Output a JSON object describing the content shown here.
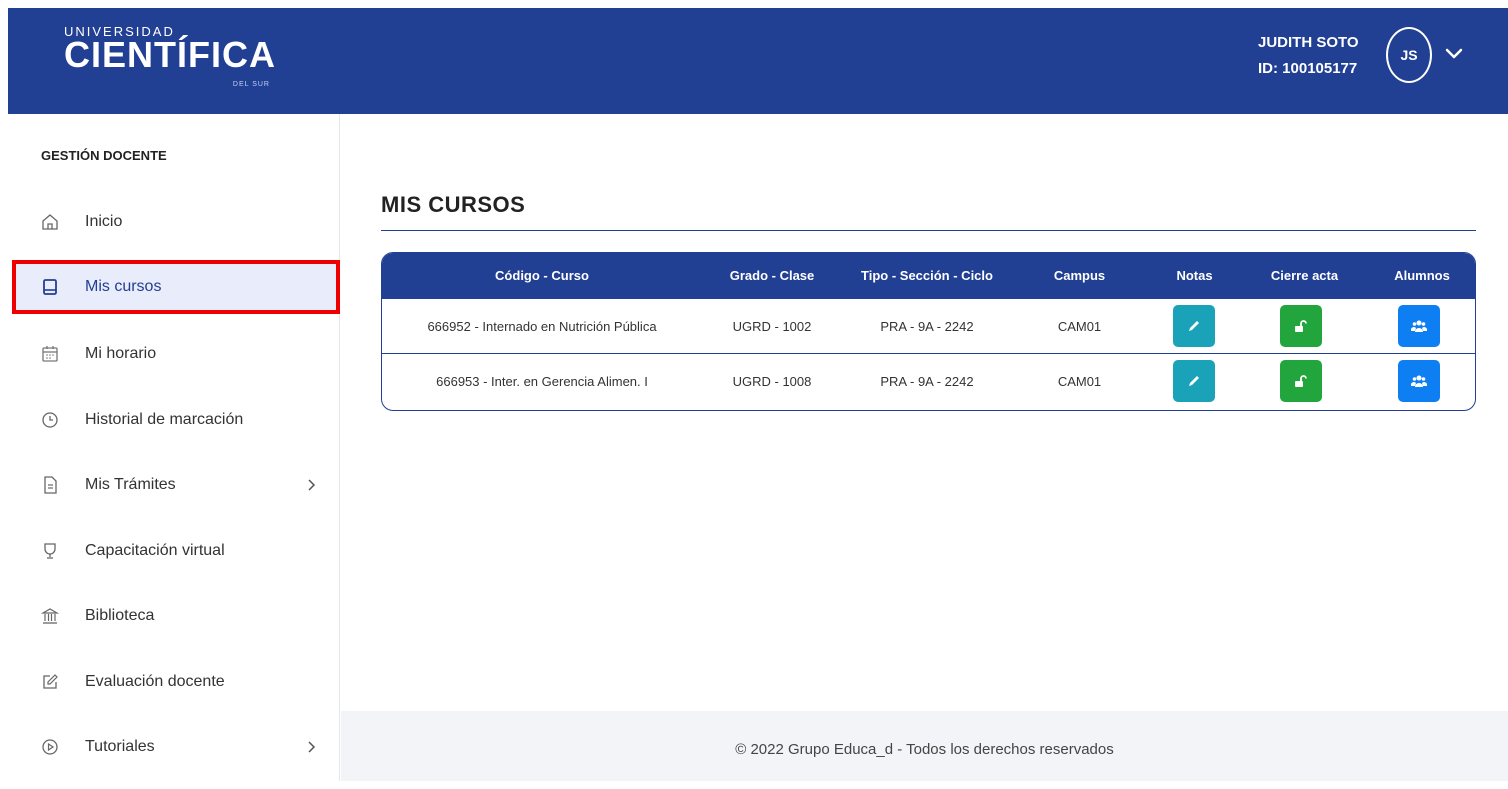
{
  "header": {
    "logo": {
      "line1": "UNIVERSIDAD",
      "line2": "CIENTÍFICA",
      "line3": "DEL SUR"
    },
    "user_name": "JUDITH SOTO",
    "user_id": "ID: 100105177",
    "avatar_initials": "JS",
    "brand_color": "#213f93"
  },
  "sidebar": {
    "heading": "GESTIÓN DOCENTE",
    "items": [
      {
        "label": "Inicio",
        "icon": "home-icon"
      },
      {
        "label": "Mis cursos",
        "icon": "book-icon",
        "active": true
      },
      {
        "label": "Mi horario",
        "icon": "calendar-icon"
      },
      {
        "label": "Historial de marcación",
        "icon": "clock-icon"
      },
      {
        "label": "Mis Trámites",
        "icon": "document-icon",
        "has_submenu": true
      },
      {
        "label": "Capacitación virtual",
        "icon": "trophy-icon"
      },
      {
        "label": "Biblioteca",
        "icon": "library-icon"
      },
      {
        "label": "Evaluación docente",
        "icon": "edit-icon"
      },
      {
        "label": "Tutoriales",
        "icon": "play-icon",
        "has_submenu": true
      }
    ]
  },
  "main": {
    "title": "MIS CURSOS",
    "table": {
      "headers": [
        "Código - Curso",
        "Grado - Clase",
        "Tipo - Sección - Ciclo",
        "Campus",
        "Notas",
        "Cierre acta",
        "Alumnos"
      ],
      "rows": [
        {
          "curso": "666952 - Internado en Nutrición Pública",
          "grado": "UGRD - 1002",
          "tipo": "PRA - 9A - 2242",
          "campus": "CAM01"
        },
        {
          "curso": "666953 - Inter. en Gerencia Alimen. I",
          "grado": "UGRD - 1008",
          "tipo": "PRA - 9A - 2242",
          "campus": "CAM01"
        }
      ]
    }
  },
  "footer": {
    "text": "© 2022 Grupo Educa_d - Todos los derechos reservados"
  }
}
